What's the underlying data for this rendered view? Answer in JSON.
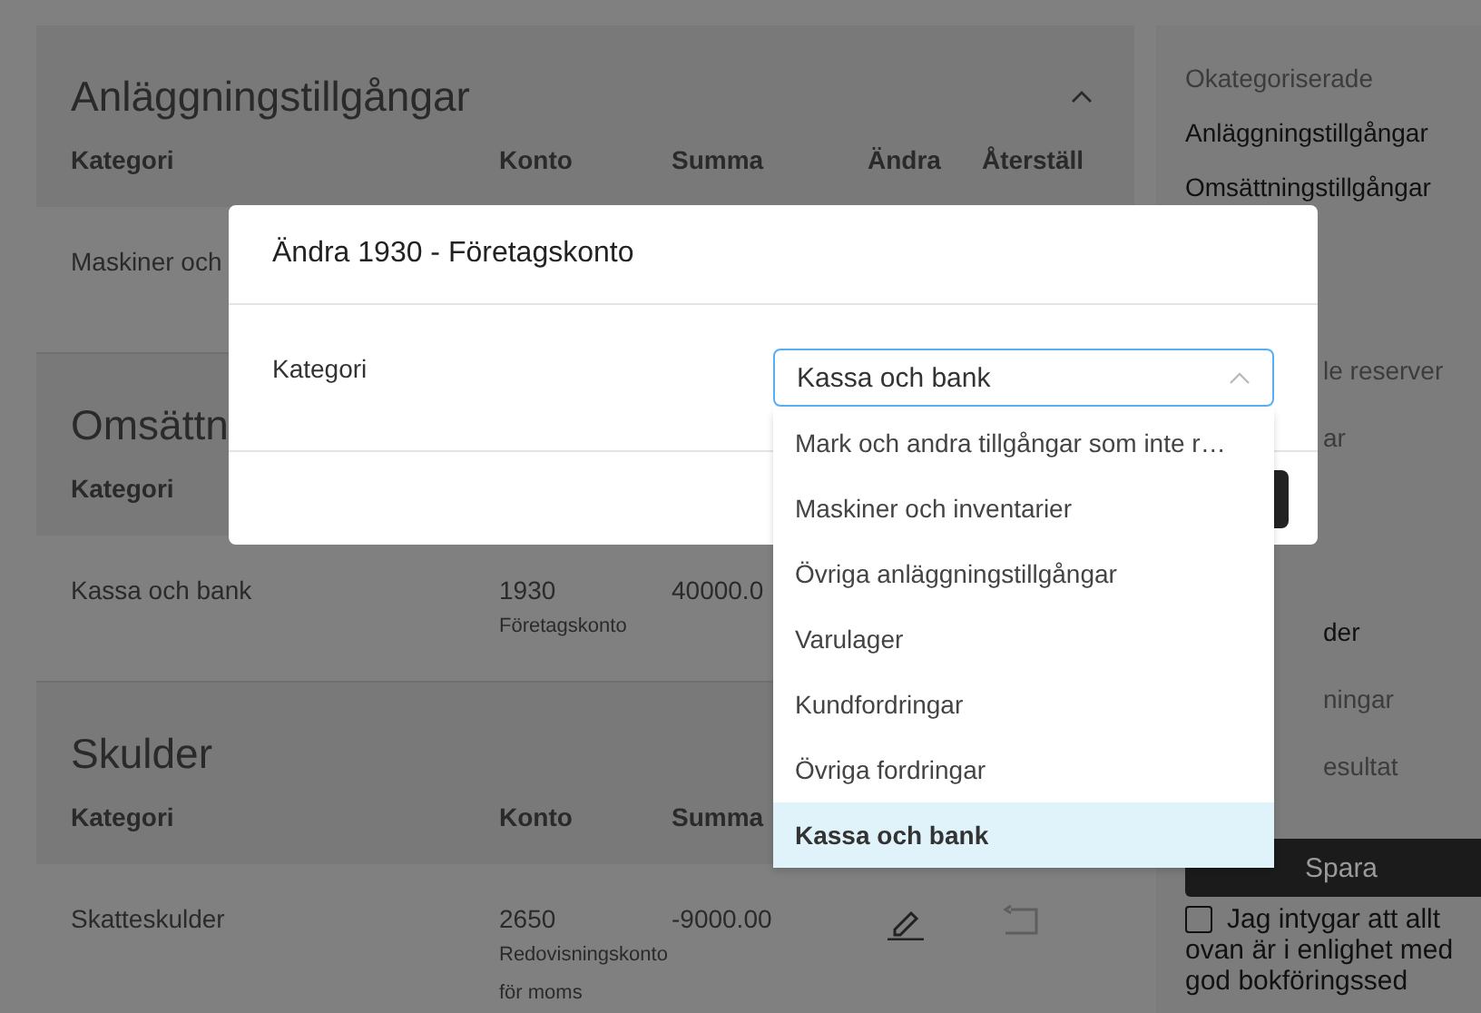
{
  "sections": [
    {
      "title": "Anläggningstillgångar",
      "expanded": true,
      "columns": [
        "Kategori",
        "Konto",
        "Summa",
        "Ändra",
        "Återställ"
      ],
      "rows": [
        {
          "category": "Maskiner och"
        }
      ]
    },
    {
      "title": "Omsättn",
      "columns": [
        "Kategori"
      ],
      "rows": [
        {
          "category": "Kassa och bank",
          "account": "1930",
          "account_name": "Företagskonto",
          "amount": "40000.0"
        }
      ]
    },
    {
      "title": "Skulder",
      "columns": [
        "Kategori",
        "Konto",
        "Summa"
      ],
      "rows": [
        {
          "category": "Skatteskulder",
          "account": "2650",
          "account_name": "Redovisningskonto för moms",
          "amount": "-9000.00",
          "editable": true,
          "reset_enabled": false
        }
      ]
    }
  ],
  "sidebar": {
    "items": [
      {
        "label": "Okategoriserade",
        "kind": "full",
        "disabled": true
      },
      {
        "label": "Anläggningstillgångar",
        "kind": "full",
        "disabled": false
      },
      {
        "label": "Omsättningstillgångar",
        "kind": "full",
        "disabled": false
      },
      {
        "label": "le reserver",
        "kind": "partial",
        "disabled": true
      },
      {
        "label": "ar",
        "kind": "partial",
        "disabled": true
      }
    ],
    "lower_items": [
      {
        "label": "der",
        "kind": "partial",
        "disabled": false
      },
      {
        "label": "ningar",
        "kind": "partial",
        "disabled": true
      },
      {
        "label": "esultat",
        "kind": "partial",
        "disabled": true
      }
    ],
    "save_button": "Spara",
    "confirm": {
      "checked": false,
      "lines": [
        "Jag intygar att allt",
        "ovan är i enlighet med god bokföringssed"
      ]
    }
  },
  "dialog": {
    "title": "Ändra 1930 - Företagskonto",
    "field_label": "Kategori",
    "value": "Kassa och bank",
    "options": [
      {
        "label": "Mark och andra tillgångar som inte r…",
        "selected": false
      },
      {
        "label": "Maskiner och inventarier",
        "selected": false
      },
      {
        "label": "Övriga anläggningstillgångar",
        "selected": false
      },
      {
        "label": "Varulager",
        "selected": false
      },
      {
        "label": "Kundfordringar",
        "selected": false
      },
      {
        "label": "Övriga fordringar",
        "selected": false
      },
      {
        "label": "Kassa och bank",
        "selected": true
      }
    ]
  }
}
